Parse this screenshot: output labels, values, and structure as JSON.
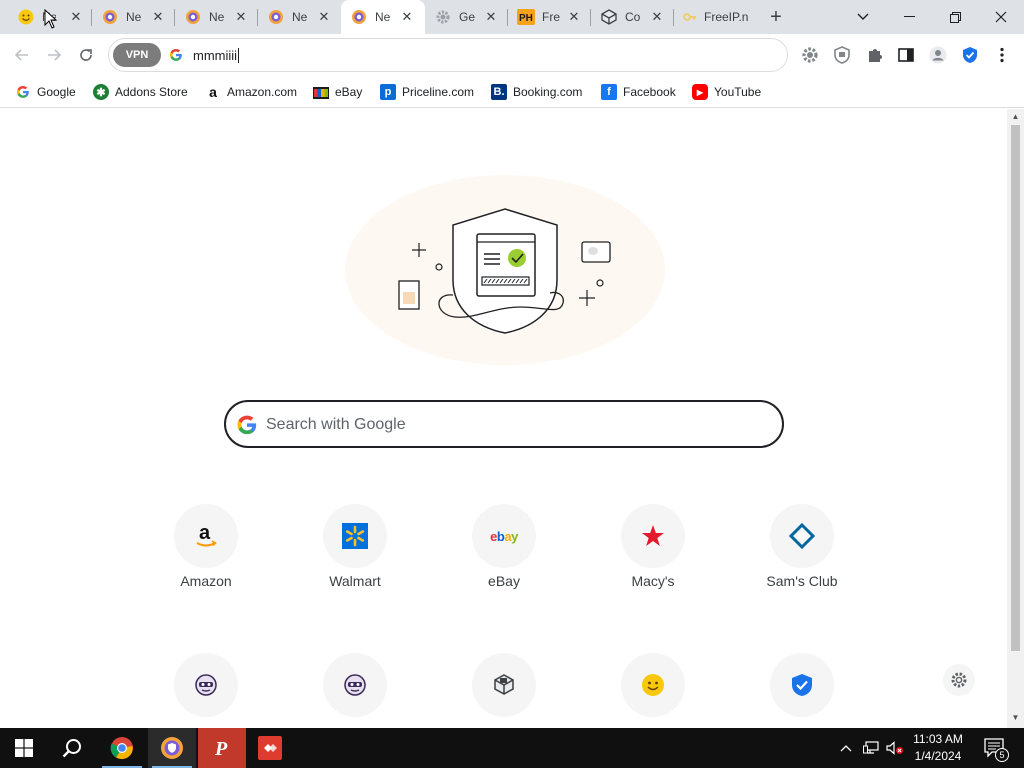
{
  "tabs": [
    {
      "title": "Ne",
      "active": false
    },
    {
      "title": "Ne",
      "active": false
    },
    {
      "title": "Ne",
      "active": false
    },
    {
      "title": "Ne",
      "active": false
    },
    {
      "title": "Ne",
      "active": true
    },
    {
      "title": "Ge",
      "active": false
    },
    {
      "title": "Fre",
      "active": false
    },
    {
      "title": "Co",
      "active": false
    },
    {
      "title": "FreeIP.n",
      "active": false
    }
  ],
  "first_tab_title": "Ne",
  "omnibox": {
    "vpn_label": "VPN",
    "value": "mmmiiii"
  },
  "bookmarks": [
    {
      "label": "Google"
    },
    {
      "label": "Addons Store"
    },
    {
      "label": "Amazon.com"
    },
    {
      "label": "eBay"
    },
    {
      "label": "Priceline.com"
    },
    {
      "label": "Booking.com"
    },
    {
      "label": "Facebook"
    },
    {
      "label": "YouTube"
    }
  ],
  "search": {
    "placeholder": "Search with Google"
  },
  "tiles_row1": [
    {
      "label": "Amazon"
    },
    {
      "label": "Walmart"
    },
    {
      "label": "eBay"
    },
    {
      "label": "Macy's"
    },
    {
      "label": "Sam's Club"
    }
  ],
  "tile_text": {
    "ebay_logo": "ebay",
    "amazon_logo": "a"
  },
  "taskbar": {
    "time": "11:03 AM",
    "date": "1/4/2024",
    "notifications": "5"
  },
  "colors": {
    "accent": "#1a73e8",
    "tabstrip": "#dee1e6",
    "taskbar": "#101010"
  }
}
